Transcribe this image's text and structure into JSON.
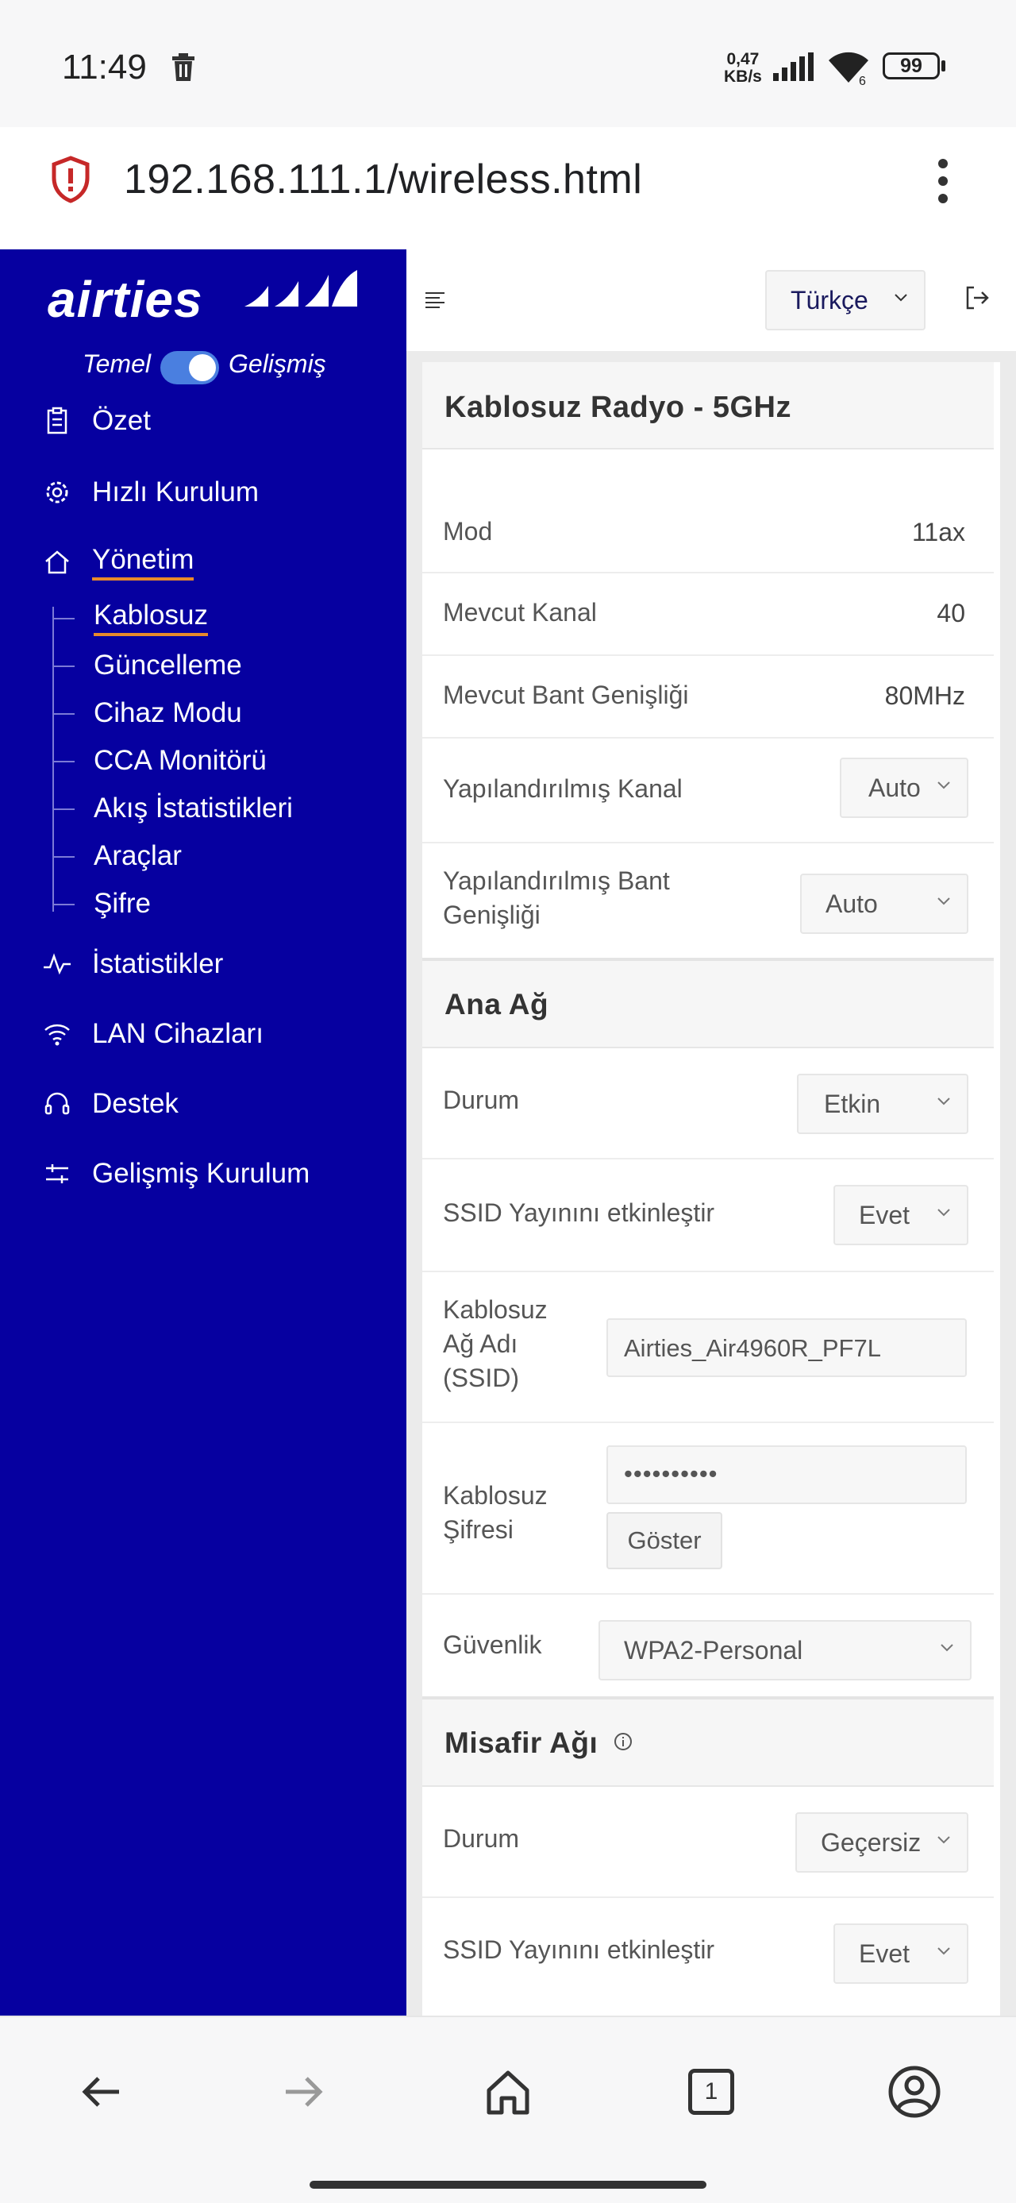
{
  "status_bar": {
    "time": "11:49",
    "net_speed_value": "0,47",
    "net_speed_unit": "KB/s",
    "battery": "99",
    "wifi_sub": "6"
  },
  "browser": {
    "url": "192.168.111.1/wireless.html",
    "tab_count": "1"
  },
  "sidebar": {
    "logo": "airties",
    "mode_basic": "Temel",
    "mode_advanced": "Gelişmiş",
    "items": [
      {
        "label": "Özet",
        "icon": "clipboard-icon"
      },
      {
        "label": "Hızlı Kurulum",
        "icon": "gear-icon"
      },
      {
        "label": "Yönetim",
        "icon": "home-icon"
      },
      {
        "label": "İstatistikler",
        "icon": "pulse-icon"
      },
      {
        "label": "LAN Cihazları",
        "icon": "wifi-icon"
      },
      {
        "label": "Destek",
        "icon": "headset-icon"
      },
      {
        "label": "Gelişmiş Kurulum",
        "icon": "sliders-icon"
      }
    ],
    "sub_items": [
      "Kablosuz",
      "Güncelleme",
      "Cihaz Modu",
      "CCA Monitörü",
      "Akış İstatistikleri",
      "Araçlar",
      "Şifre"
    ]
  },
  "topbar": {
    "language": "Türkçe"
  },
  "radio": {
    "title": "Kablosuz Radyo - 5GHz",
    "mode_label": "Mod",
    "mode_value": "11ax",
    "channel_label": "Mevcut Kanal",
    "channel_value": "40",
    "bandwidth_label": "Mevcut Bant Genişliği",
    "bandwidth_value": "80MHz",
    "cfg_channel_label": "Yapılandırılmış Kanal",
    "cfg_channel_value": "Auto",
    "cfg_bandwidth_label_1": "Yapılandırılmış Bant",
    "cfg_bandwidth_label_2": "Genişliği",
    "cfg_bandwidth_value": "Auto"
  },
  "main_network": {
    "title": "Ana Ağ",
    "status_label": "Durum",
    "status_value": "Etkin",
    "ssid_broadcast_label": "SSID Yayınını etkinleştir",
    "ssid_broadcast_value": "Evet",
    "ssid_label_1": "Kablosuz",
    "ssid_label_2": "Ağ Adı",
    "ssid_label_3": "(SSID)",
    "ssid_value": "Airties_Air4960R_PF7L",
    "password_label_1": "Kablosuz",
    "password_label_2": "Şifresi",
    "password_value": "••••••••••",
    "show_button": "Göster",
    "security_label": "Güvenlik",
    "security_value": "WPA2-Personal"
  },
  "guest_network": {
    "title": "Misafir Ağı",
    "status_label": "Durum",
    "status_value": "Geçersiz",
    "ssid_broadcast_label": "SSID Yayınını etkinleştir",
    "ssid_broadcast_value": "Evet"
  }
}
